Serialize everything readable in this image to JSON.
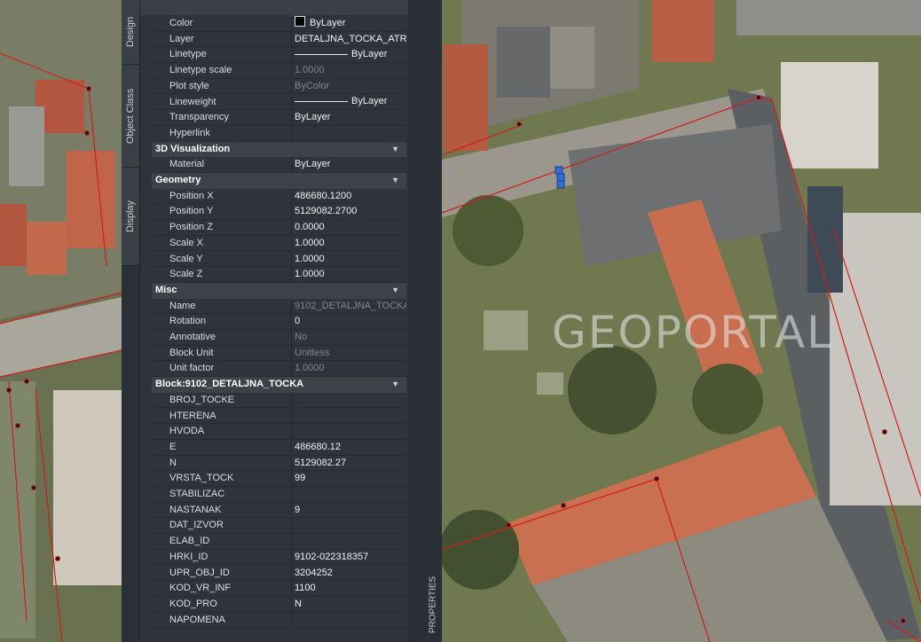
{
  "side_tabs": [
    "Design",
    "Object Class",
    "Display"
  ],
  "properties_tab": "PROPERTIES",
  "watermark": "GEOPORTAL",
  "general": [
    {
      "key": "Color",
      "value": "ByLayer",
      "kind": "color"
    },
    {
      "key": "Layer",
      "value": "DETALJNA_TOCKA_ATR"
    },
    {
      "key": "Linetype",
      "value": "ByLayer",
      "kind": "line"
    },
    {
      "key": "Linetype scale",
      "value": "1.0000",
      "dim": true
    },
    {
      "key": "Plot style",
      "value": "ByColor",
      "dim": true
    },
    {
      "key": "Lineweight",
      "value": "ByLayer",
      "kind": "line"
    },
    {
      "key": "Transparency",
      "value": "ByLayer"
    },
    {
      "key": "Hyperlink",
      "value": ""
    }
  ],
  "sections": {
    "viz": "3D Visualization",
    "geometry": "Geometry",
    "misc": "Misc",
    "block": "Block:9102_DETALJNA_TOCKA"
  },
  "viz": [
    {
      "key": "Material",
      "value": "ByLayer"
    }
  ],
  "geometry": [
    {
      "key": "Position X",
      "value": "486680.1200"
    },
    {
      "key": "Position Y",
      "value": "5129082.2700"
    },
    {
      "key": "Position Z",
      "value": "0.0000"
    },
    {
      "key": "Scale X",
      "value": "1.0000"
    },
    {
      "key": "Scale Y",
      "value": "1.0000"
    },
    {
      "key": "Scale Z",
      "value": "1.0000"
    }
  ],
  "misc": [
    {
      "key": "Name",
      "value": "9102_DETALJNA_TOCKA",
      "dim": true
    },
    {
      "key": "Rotation",
      "value": "0"
    },
    {
      "key": "Annotative",
      "value": "No",
      "dim": true
    },
    {
      "key": "Block Unit",
      "value": "Unitless",
      "dim": true
    },
    {
      "key": "Unit factor",
      "value": "1.0000",
      "dim": true
    }
  ],
  "block": [
    {
      "key": "BROJ_TOCKE",
      "value": ""
    },
    {
      "key": "HTERENA",
      "value": ""
    },
    {
      "key": "HVODA",
      "value": ""
    },
    {
      "key": "E",
      "value": "486680.12"
    },
    {
      "key": "N",
      "value": "5129082.27"
    },
    {
      "key": "VRSTA_TOCK",
      "value": "99"
    },
    {
      "key": "STABILIZAC",
      "value": ""
    },
    {
      "key": "NASTANAK",
      "value": "9"
    },
    {
      "key": "DAT_IZVOR",
      "value": ""
    },
    {
      "key": "ELAB_ID",
      "value": ""
    },
    {
      "key": "HRKI_ID",
      "value": "9102-022318357"
    },
    {
      "key": "UPR_OBJ_ID",
      "value": "3204252"
    },
    {
      "key": "KOD_VR_INF",
      "value": "1100"
    },
    {
      "key": "KOD_PRO",
      "value": "N"
    },
    {
      "key": "NAPOMENA",
      "value": ""
    }
  ]
}
